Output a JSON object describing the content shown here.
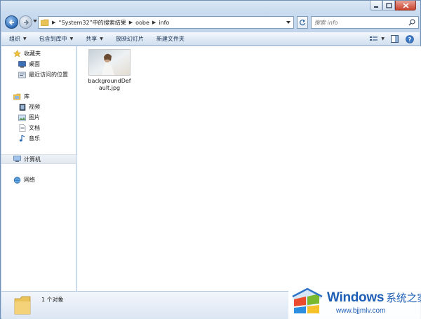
{
  "window": {
    "caption_buttons": [
      "minimize-icon",
      "maximize-icon",
      "close-icon"
    ]
  },
  "address": {
    "breadcrumbs": [
      "“System32”中的搜索结果",
      "oobe",
      "info"
    ]
  },
  "search": {
    "placeholder": "搜索 info"
  },
  "toolbar": {
    "organize": "组织",
    "include_in_library": "包含到库中",
    "share": "共享",
    "slideshow": "放映幻灯片",
    "new_folder": "新建文件夹"
  },
  "sidebar": {
    "favorites": {
      "label": "收藏夹",
      "items": [
        {
          "label": "桌面",
          "icon": "desktop-icon"
        },
        {
          "label": "最近访问的位置",
          "icon": "recent-places-icon"
        }
      ]
    },
    "libraries": {
      "label": "库",
      "items": [
        {
          "label": "视频",
          "icon": "video-icon"
        },
        {
          "label": "图片",
          "icon": "pictures-icon"
        },
        {
          "label": "文档",
          "icon": "documents-icon"
        },
        {
          "label": "音乐",
          "icon": "music-icon"
        }
      ]
    },
    "computer": {
      "label": "计算机",
      "icon": "computer-icon"
    },
    "network": {
      "label": "网络",
      "icon": "network-icon"
    }
  },
  "content": {
    "files": [
      {
        "name": "backgroundDefault.jpg",
        "icon": "image-thumbnail"
      }
    ]
  },
  "details": {
    "item_count": "1 个对象"
  },
  "watermark": {
    "title": "Windows",
    "suffix": "系统之家",
    "url": "www.bjjmlv.com"
  },
  "colors": {
    "frame": "#c9dbef",
    "toolbar_text": "#1e3757",
    "watermark_blue": "#1e5fb5"
  }
}
